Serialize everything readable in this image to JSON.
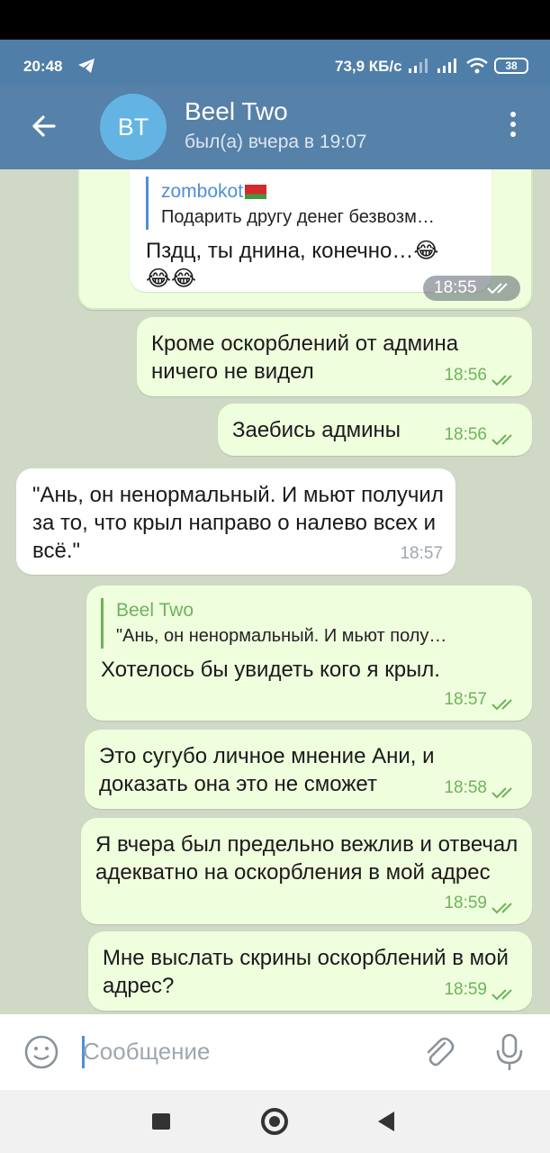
{
  "status_bar": {
    "time": "20:48",
    "speed": "73,9 КБ/с",
    "battery": "38"
  },
  "header": {
    "avatar_initials": "BT",
    "contact_name": "Beel Two",
    "last_seen": "был(а) вчера в 19:07",
    "accent_color": "#5681a8"
  },
  "messages": [
    {
      "side": "in",
      "reply_name": "zombokot",
      "reply_text": "Подарить другу денег безвозм…",
      "text": "Пздц, ты днина, конечно…😂😂😂",
      "time": "18:55"
    },
    {
      "side": "out",
      "text": "Кроме оскорблений от админа ничего не видел",
      "time": "18:56"
    },
    {
      "side": "out",
      "text": "Заебись админы",
      "time": "18:56"
    },
    {
      "side": "in",
      "text": "\"Ань, он ненормальный. И мьют получил за то, что крыл направо о налево всех и всё.\"",
      "time": "18:57"
    },
    {
      "side": "out",
      "reply_name": "Beel Two",
      "reply_text": "\"Ань, он ненормальный. И мьют полу…",
      "text": "Хотелось бы увидеть кого я крыл.",
      "time": "18:57"
    },
    {
      "side": "out",
      "text": "Это сугубо личное мнение Ани, и доказать она это не сможет",
      "time": "18:58"
    },
    {
      "side": "out",
      "text": "Я вчера был предельно вежлив и отвечал адекватно на оскорбления в мой адрес",
      "time": "18:59"
    },
    {
      "side": "out",
      "text": "Мне выслать скрины оскорблений в мой адрес?",
      "time": "18:59"
    }
  ],
  "composer": {
    "placeholder": "Сообщение"
  }
}
